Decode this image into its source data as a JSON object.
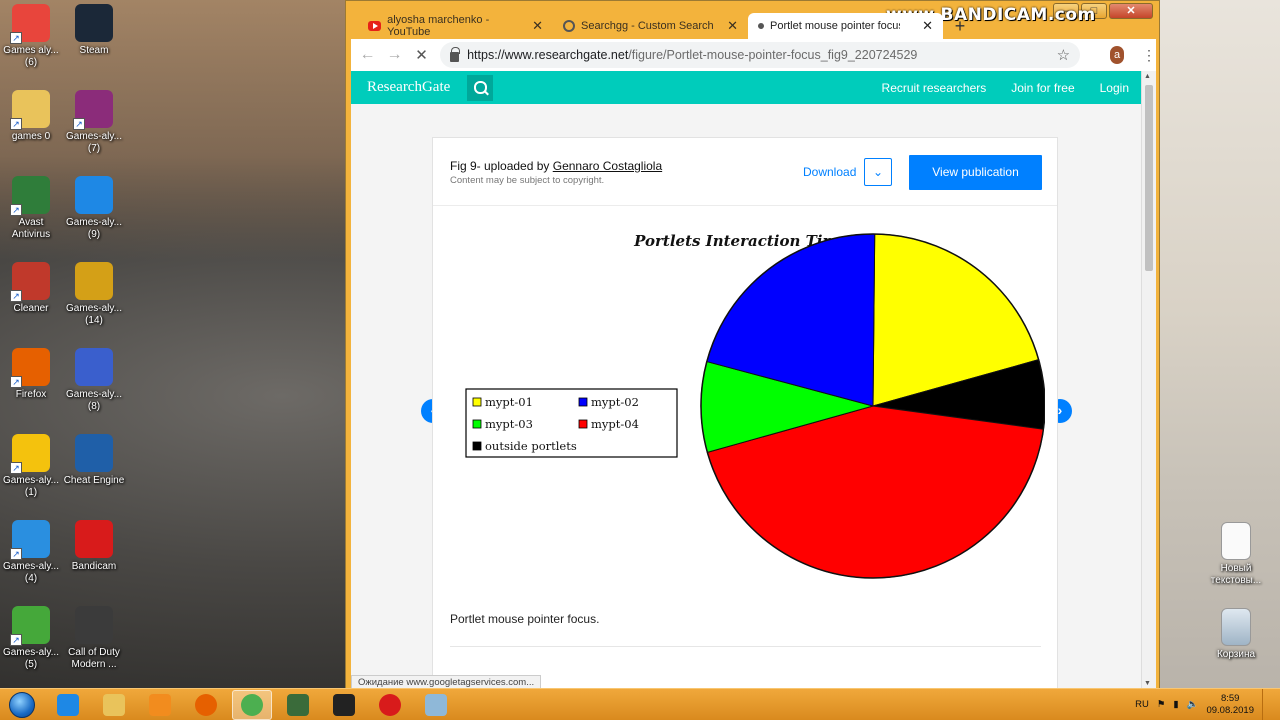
{
  "desktop": {
    "icons": [
      {
        "label": "Games aly...\n(6)",
        "glyph": "chrome-icon",
        "color": "#e8453c"
      },
      {
        "label": "Steam",
        "glyph": "steam-icon",
        "color": "#1b2838"
      },
      {
        "label": "games 0",
        "glyph": "folder-icon",
        "color": "#e9c35b"
      },
      {
        "label": "Games-aly...\n(7)",
        "glyph": "winrar-icon",
        "color": "#8b2c7a"
      },
      {
        "label": "Avast\nAntivirus",
        "glyph": "avast-icon",
        "color": "#2f7d3a"
      },
      {
        "label": "Games-aly...\n(9)",
        "glyph": "ie-icon",
        "color": "#1e88e5"
      },
      {
        "label": "Cleaner",
        "glyph": "ccleaner-icon",
        "color": "#c0392b"
      },
      {
        "label": "Games-aly...\n(14)",
        "glyph": "archive-icon",
        "color": "#d4a017"
      },
      {
        "label": "Firefox",
        "glyph": "firefox-icon",
        "color": "#e66000"
      },
      {
        "label": "Games-aly...\n(8)",
        "glyph": "floppy-icon",
        "color": "#3a5fcd"
      },
      {
        "label": "Games-aly...\n(1)",
        "glyph": "star-icon",
        "color": "#f4c20d"
      },
      {
        "label": "Cheat Engine",
        "glyph": "cheat-engine-icon",
        "color": "#1f5fa8"
      },
      {
        "label": "Games-aly...\n(4)",
        "glyph": "bolt-icon",
        "color": "#2a8fe0"
      },
      {
        "label": "Bandicam",
        "glyph": "bandicam-icon",
        "color": "#d81b1b"
      },
      {
        "label": "Games-aly...\n(5)",
        "glyph": "utorrent-icon",
        "color": "#45a83a"
      },
      {
        "label": "Call of Duty\nModern ...",
        "glyph": "cod-icon",
        "color": "#3b3b3b"
      }
    ],
    "right_icons": [
      {
        "label": "Новый\nтекстовы...",
        "glyph": "text-file-icon"
      },
      {
        "label": "Корзина",
        "glyph": "recycle-bin-icon"
      }
    ]
  },
  "watermark": "www.BANDICAM.com",
  "browser": {
    "tabs": [
      {
        "title": "alyosha marchenko - YouTube",
        "icon": "youtube-icon"
      },
      {
        "title": "Searchgg - Custom Search",
        "icon": "globe-icon"
      },
      {
        "title": "Portlet mouse pointer focus. | Do",
        "icon": "loading-icon"
      }
    ],
    "url_host": "https://www.researchgate.net",
    "url_path": "/figure/Portlet-mouse-pointer-focus_fig9_220724529",
    "profile_initial": "a",
    "status_text": "Ожидание www.googletagservices.com..."
  },
  "site": {
    "logo": "ResearchGate",
    "nav": [
      "Recruit researchers",
      "Join for free",
      "Login"
    ],
    "fig_prefix": "Fig 9- uploaded by ",
    "author": "Gennaro Costagliola",
    "copyright_note": "Content may be subject to copyright.",
    "download_label": "Download",
    "view_publication_label": "View publication",
    "caption": "Portlet mouse pointer focus.",
    "accent": "#00ccbb",
    "link_color": "#0080ff"
  },
  "chart_data": {
    "type": "pie",
    "title": "Portlets Interaction Time",
    "legend_position": "left",
    "slices": [
      {
        "label": "mypt-01",
        "value": 20.5,
        "color": "#ffff00"
      },
      {
        "label": "outside portlets",
        "value": 6.5,
        "color": "#000000"
      },
      {
        "label": "mypt-04",
        "value": 43.5,
        "color": "#ff0000"
      },
      {
        "label": "mypt-03",
        "value": 8.5,
        "color": "#00ff00"
      },
      {
        "label": "mypt-02",
        "value": 21.0,
        "color": "#0000ff"
      }
    ],
    "legend": [
      {
        "label": "mypt-01",
        "color": "#ffff00"
      },
      {
        "label": "mypt-02",
        "color": "#0000ff"
      },
      {
        "label": "mypt-03",
        "color": "#00ff00"
      },
      {
        "label": "mypt-04",
        "color": "#ff0000"
      },
      {
        "label": "outside portlets",
        "color": "#000000"
      }
    ]
  },
  "taskbar": {
    "items": [
      "windows-explorer-icon",
      "ie-icon",
      "folder-icon",
      "media-player-icon",
      "firefox-icon",
      "chrome-icon",
      "terminal-icon",
      "nfs-icon",
      "bandicam-icon",
      "window-icon"
    ],
    "active_item": "chrome-icon",
    "language": "RU",
    "time": "8:59",
    "date": "09.08.2019"
  }
}
